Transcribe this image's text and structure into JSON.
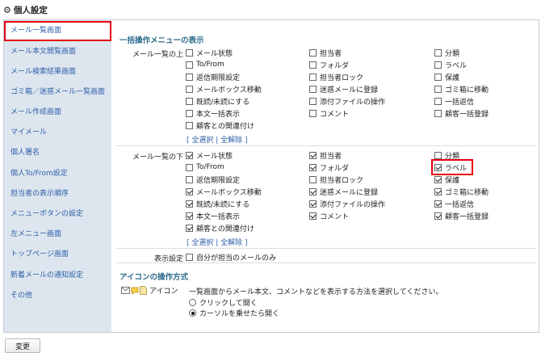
{
  "page": {
    "title": "個人設定"
  },
  "sidebar": {
    "items": [
      {
        "label": "メール一覧画面"
      },
      {
        "label": "メール本文閲覧画面"
      },
      {
        "label": "メール検索結果画面"
      },
      {
        "label": "ゴミ箱／迷惑メール一覧画面"
      },
      {
        "label": "メール作成画面"
      },
      {
        "label": "マイメール"
      },
      {
        "label": "個人署名"
      },
      {
        "label": "個人To/From設定"
      },
      {
        "label": "担当者の表示順序"
      },
      {
        "label": "メニューボタンの設定"
      },
      {
        "label": "左メニュー画面"
      },
      {
        "label": "トップページ画面"
      },
      {
        "label": "新着メールの通知設定"
      },
      {
        "label": "その他"
      }
    ],
    "active_index": 0
  },
  "bulk_menu": {
    "title": "一括操作メニューの表示",
    "top": {
      "label": "メール一覧の上",
      "items": [
        {
          "label": "メール状態",
          "checked": false
        },
        {
          "label": "担当者",
          "checked": false
        },
        {
          "label": "分類",
          "checked": false
        },
        {
          "label": "To/From",
          "checked": false
        },
        {
          "label": "フォルダ",
          "checked": false
        },
        {
          "label": "ラベル",
          "checked": false
        },
        {
          "label": "返信期限設定",
          "checked": false
        },
        {
          "label": "担当者ロック",
          "checked": false
        },
        {
          "label": "保護",
          "checked": false
        },
        {
          "label": "メールボックス移動",
          "checked": false
        },
        {
          "label": "迷惑メールに登録",
          "checked": false
        },
        {
          "label": "ゴミ箱に移動",
          "checked": false
        },
        {
          "label": "既読/未読にする",
          "checked": false
        },
        {
          "label": "添付ファイルの操作",
          "checked": false
        },
        {
          "label": "一括返信",
          "checked": false
        },
        {
          "label": "本文一括表示",
          "checked": false
        },
        {
          "label": "コメント",
          "checked": false
        },
        {
          "label": "顧客一括登録",
          "checked": false
        },
        {
          "label": "顧客との関連付け",
          "checked": false
        }
      ],
      "links": {
        "select_all": "全選択",
        "deselect_all": "全解除"
      }
    },
    "bottom": {
      "label": "メール一覧の下",
      "items": [
        {
          "label": "メール状態",
          "checked": true
        },
        {
          "label": "担当者",
          "checked": true
        },
        {
          "label": "分類",
          "checked": false
        },
        {
          "label": "To/From",
          "checked": false
        },
        {
          "label": "フォルダ",
          "checked": true
        },
        {
          "label": "ラベル",
          "checked": true
        },
        {
          "label": "返信期限設定",
          "checked": false
        },
        {
          "label": "担当者ロック",
          "checked": false
        },
        {
          "label": "保護",
          "checked": true
        },
        {
          "label": "メールボックス移動",
          "checked": true
        },
        {
          "label": "迷惑メールに登録",
          "checked": true
        },
        {
          "label": "ゴミ箱に移動",
          "checked": true
        },
        {
          "label": "既読/未読にする",
          "checked": true
        },
        {
          "label": "添付ファイルの操作",
          "checked": true
        },
        {
          "label": "一括返信",
          "checked": true
        },
        {
          "label": "本文一括表示",
          "checked": true
        },
        {
          "label": "コメント",
          "checked": true
        },
        {
          "label": "顧客一括登録",
          "checked": true
        },
        {
          "label": "顧客との関連付け",
          "checked": true
        }
      ],
      "links": {
        "select_all": "全選択",
        "deselect_all": "全解除"
      }
    },
    "display": {
      "label": "表示設定",
      "option": {
        "label": "自分が担当のメールのみ",
        "checked": false
      }
    }
  },
  "icon_ops": {
    "title": "アイコンの操作方式",
    "label": "アイコン",
    "description": "一覧画面からメール本文、コメントなどを表示する方法を選択してください。",
    "options": [
      {
        "label": "クリックして開く",
        "selected": false
      },
      {
        "label": "カーソルを乗せたら開く",
        "selected": true
      }
    ]
  },
  "footer": {
    "submit_label": "変更"
  },
  "colors": {
    "accent_red": "#e60012",
    "link_blue": "#2e5ea7",
    "sidebar_bg": "#dde6ef",
    "section_title": "#2a6a8a"
  }
}
